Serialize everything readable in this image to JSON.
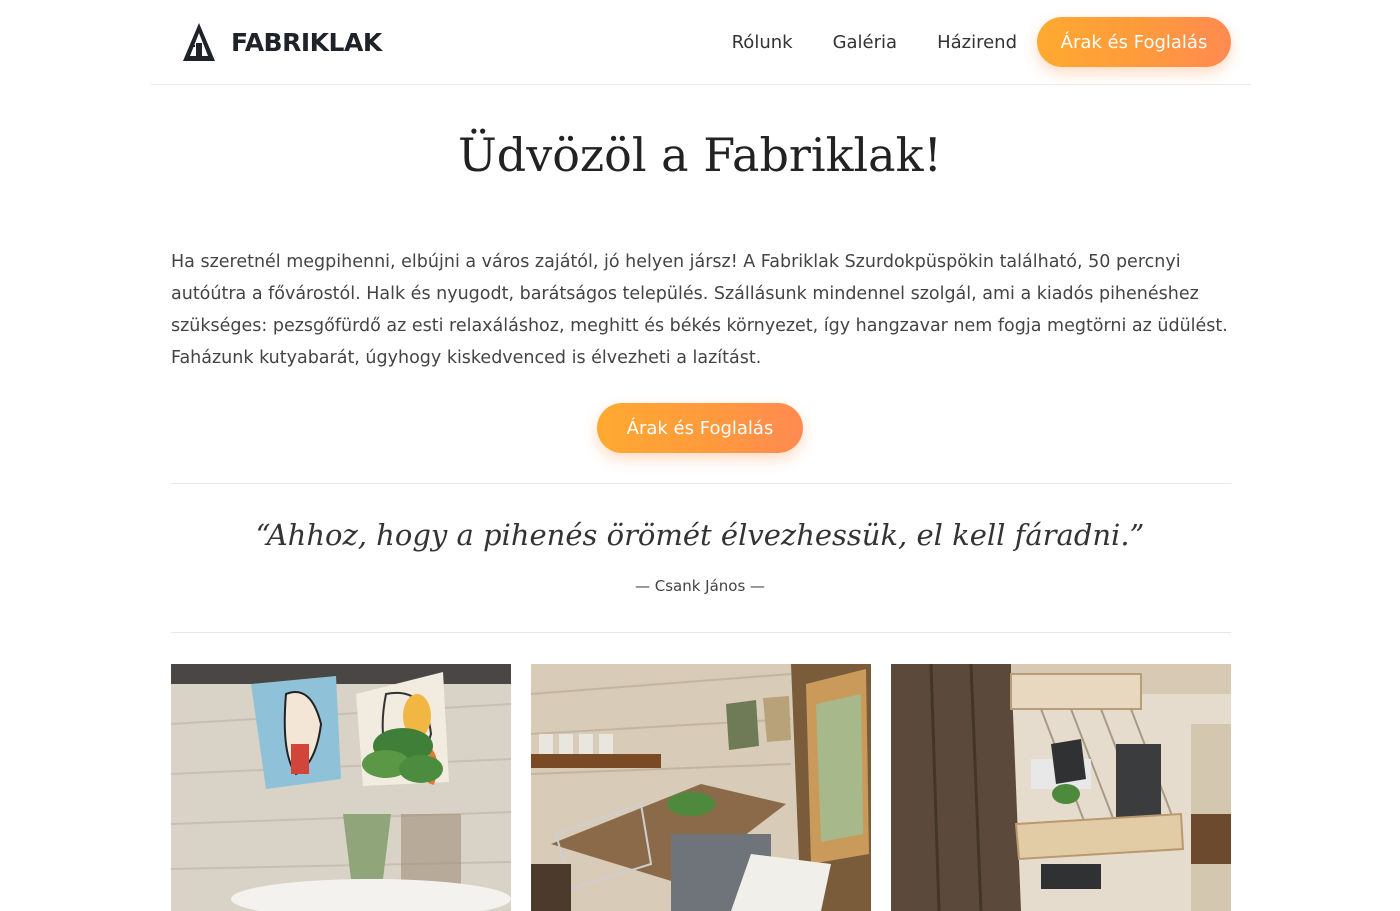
{
  "brand": {
    "name": "FABRIKLAK",
    "logo_icon": "house-a-logo-icon"
  },
  "nav": {
    "links": [
      "Rólunk",
      "Galéria",
      "Házirend"
    ],
    "cta": "Árak és Foglalás"
  },
  "hero": {
    "title": "Üdvözöl a Fabriklak!",
    "paragraph": "Ha szeretnél megpihenni, elbújni a város zajától, jó helyen jársz! A Fabriklak Szurdokpüspökin található, 50 percnyi autóútra a fővárostól. Halk és nyugodt, barátságos település. Szállásunk mindennel szolgál, ami a kiadós pihenéshez szükséges: pezsgőfürdő az esti relaxáláshoz, meghitt és békés környezet, így hangzavar nem fogja megtörni az üdülést. Faházunk kutyabarát, úgyhogy kiskedvenced is élvezheti a lazítást.",
    "cta": "Árak és Foglalás"
  },
  "quote": {
    "text": "“Ahhoz, hogy a pihenés örömét élvezhessük, el kell fáradni.”",
    "author": "— Csank János —"
  },
  "gallery": [
    "wall-art-plant-photo",
    "kitchen-interior-photo",
    "loft-interior-photo"
  ],
  "colors": {
    "accent_start": "#ffa931",
    "accent_end": "#ff8a52",
    "text": "#333333",
    "divider": "#e8e8e8"
  }
}
